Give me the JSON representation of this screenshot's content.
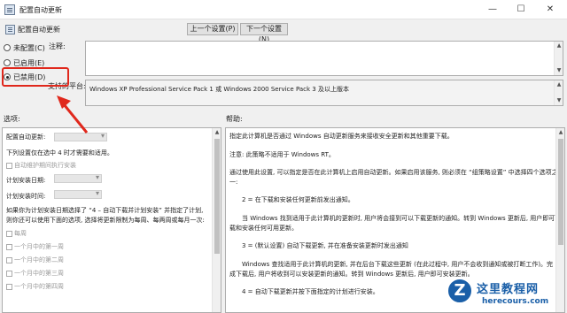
{
  "window": {
    "title": "配置自动更新",
    "minimize": "—",
    "maximize": "☐",
    "close": "✕"
  },
  "header": {
    "title": "配置自动更新",
    "prev_button": "上一个设置(P)",
    "next_button": "下一个设置(N)"
  },
  "state": {
    "options": [
      {
        "label": "未配置(C)",
        "selected": false
      },
      {
        "label": "已启用(E)",
        "selected": false
      },
      {
        "label": "已禁用(D)",
        "selected": true
      }
    ]
  },
  "comment_label": "注释:",
  "supported_label": "支持的平台:",
  "supported_value": "Windows XP Professional Service Pack 1 或 Windows 2000 Service Pack 3 及以上版本",
  "options_label": "选项:",
  "help_label": "帮助:",
  "options": {
    "configure_label": "配置自动更新:",
    "line1": "下列设置仅在选中 4 时才需要和适用。",
    "install_during_maintenance": "自动维护期间执行安装",
    "schedule_day_label": "计划安装日期:",
    "schedule_time_label": "计划安装时间:",
    "para1": "如果你为计划安装日期选择了 “4 – 自动下载并计划安装” 并指定了计划,",
    "para2": "则你还可以使用下面的选项, 选择将更新限制为每周、每两周或每月一次:",
    "every_week": "每周",
    "first_week": "一个月中的第一周",
    "second_week": "一个月中的第二周",
    "third_week": "一个月中的第三周",
    "fourth_week": "一个月中的第四周"
  },
  "help": {
    "lines": [
      "指定此计算机是否通过 Windows 自动更新服务来接收安全更新和其他重要下载。",
      "注意: 此策略不适用于 Windows RT。",
      "通过使用此设置, 可以指定是否在此计算机上启用自动更新。如果启用该服务, 则必须在 “组策略设置” 中选择四个选项之",
      "一:",
      "2 = 在下载和安装任何更新前发出通知。",
      "当 Windows 找到适用于此计算机的更新时, 用户将会接到可以下载更新的通知。转到 Windows 更新后, 用户即可下",
      "载和安装任何可用更新。",
      "3 = (默认设置) 自动下载更新, 并在准备安装更新时发出通知",
      "Windows 查找适用于此计算机的更新, 并在后台下载这些更新 (在此过程中, 用户不会收到通知或被打断工作)。完",
      "成下载后, 用户将收到可以安装更新的通知。转到 Windows 更新后, 用户即可安装更新。",
      "4 = 自动下载更新并按下面指定的计划进行安装。"
    ]
  },
  "watermark": {
    "logo_letter": "Z",
    "name": "这里教程网",
    "url": "herecours.com"
  },
  "colors": {
    "annotation": "#e0281c",
    "watermark": "#1a5fa8"
  }
}
